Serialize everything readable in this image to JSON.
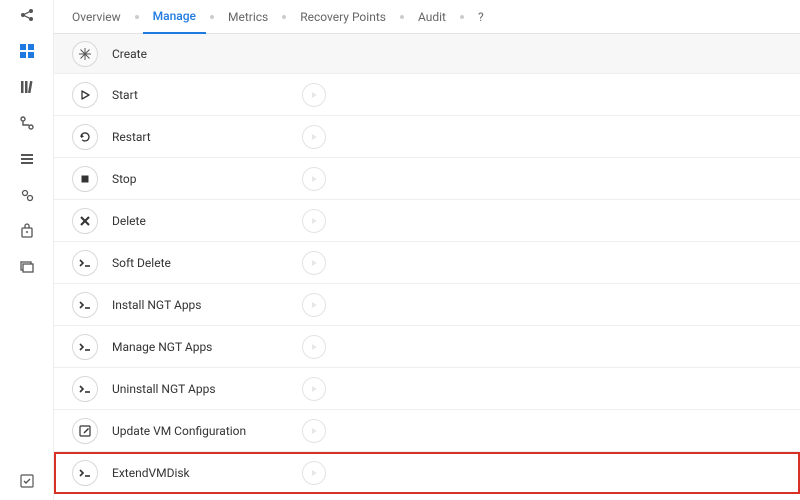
{
  "sidebar": {
    "items": [
      {
        "name": "share-icon"
      },
      {
        "name": "apps-icon",
        "active": true
      },
      {
        "name": "library-icon"
      },
      {
        "name": "branch-icon"
      },
      {
        "name": "list-icon"
      },
      {
        "name": "settings-icon"
      },
      {
        "name": "bag-icon"
      },
      {
        "name": "stack-icon"
      }
    ],
    "footer": {
      "name": "checklist-icon"
    }
  },
  "tabs": {
    "items": [
      {
        "label": "Overview"
      },
      {
        "label": "Manage",
        "active": true
      },
      {
        "label": "Metrics"
      },
      {
        "label": "Recovery Points"
      },
      {
        "label": "Audit"
      },
      {
        "label": "?"
      }
    ]
  },
  "actions": {
    "header": {
      "label": "Create",
      "icon": "create"
    },
    "items": [
      {
        "label": "Start",
        "icon": "play"
      },
      {
        "label": "Restart",
        "icon": "restart"
      },
      {
        "label": "Stop",
        "icon": "stop"
      },
      {
        "label": "Delete",
        "icon": "delete"
      },
      {
        "label": "Soft Delete",
        "icon": "terminal"
      },
      {
        "label": "Install NGT Apps",
        "icon": "terminal"
      },
      {
        "label": "Manage NGT Apps",
        "icon": "terminal"
      },
      {
        "label": "Uninstall NGT Apps",
        "icon": "terminal"
      },
      {
        "label": "Update VM Configuration",
        "icon": "edit"
      },
      {
        "label": "ExtendVMDisk",
        "icon": "terminal",
        "highlight": true
      }
    ]
  }
}
